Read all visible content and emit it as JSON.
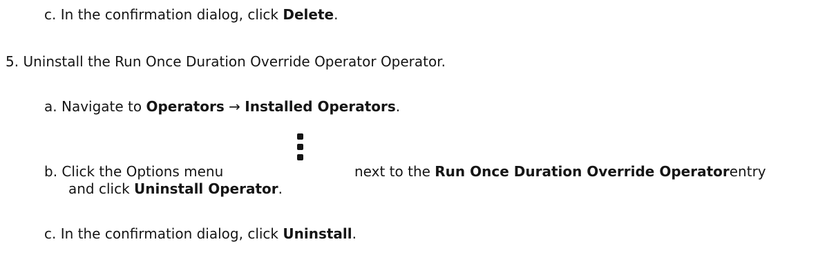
{
  "step_4c": {
    "marker": "c.",
    "prefix": "In the confirmation dialog, click ",
    "bold": "Delete",
    "suffix": "."
  },
  "step_5": {
    "marker": "5.",
    "text": "Uninstall the Run Once Duration Override Operator Operator."
  },
  "step_5a": {
    "marker": "a.",
    "prefix": "Navigate to ",
    "bold_1": "Operators",
    "arrow": " → ",
    "bold_2": "Installed Operators",
    "suffix": "."
  },
  "step_5b": {
    "marker": "b.",
    "prefix": "Click the Options menu",
    "icon": "kebab-menu-icon",
    "middle": "next to the ",
    "bold_1": "Run Once Duration Override Operator",
    "after_bold": "entry",
    "line2_prefix": "and click ",
    "bold_2": "Uninstall Operator",
    "suffix": "."
  },
  "step_5c": {
    "marker": "c.",
    "prefix": "In the confirmation dialog, click ",
    "bold": "Uninstall",
    "suffix": "."
  }
}
